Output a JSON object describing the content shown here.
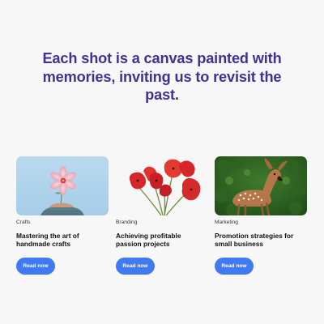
{
  "hero": {
    "headline": "Each shot is a canvas painted with memories, inviting us to revisit the past."
  },
  "colors": {
    "headline": "#3d3392",
    "button": "#3f7af2",
    "background": "#f7f7f7"
  },
  "cards": [
    {
      "category": "Crafts",
      "title": "Mastering the art of handmade crafts",
      "button_label": "Read now",
      "image": "pink-flower-in-hand-photo"
    },
    {
      "category": "Branding",
      "title": "Achieving profitable passion projects",
      "button_label": "Read now",
      "image": "red-poppies-photo"
    },
    {
      "category": "Marketing",
      "title": "Promotion strategies for small business",
      "button_label": "Read now",
      "image": "fawn-deer-photo"
    }
  ]
}
